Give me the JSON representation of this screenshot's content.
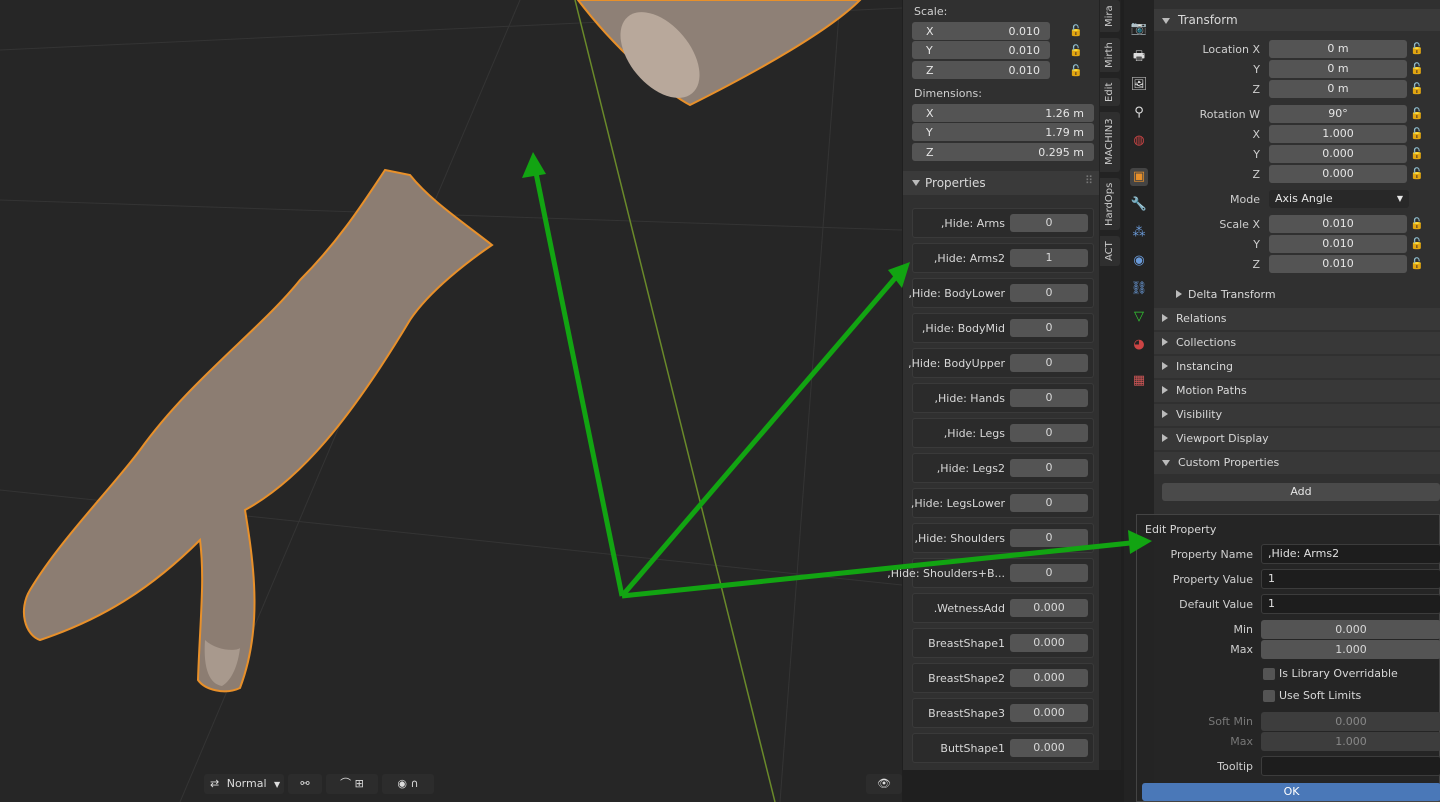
{
  "npanel": {
    "scale_label": "Scale:",
    "scale": [
      {
        "axis": "X",
        "value": "0.010"
      },
      {
        "axis": "Y",
        "value": "0.010"
      },
      {
        "axis": "Z",
        "value": "0.010"
      }
    ],
    "dimensions_label": "Dimensions:",
    "dimensions": [
      {
        "axis": "X",
        "value": "1.26 m"
      },
      {
        "axis": "Y",
        "value": "1.79 m"
      },
      {
        "axis": "Z",
        "value": "0.295 m"
      }
    ],
    "properties_title": "Properties",
    "properties": [
      {
        "name": ",Hide: Arms",
        "value": "0"
      },
      {
        "name": ",Hide: Arms2",
        "value": "1"
      },
      {
        "name": ",Hide: BodyLower",
        "value": "0"
      },
      {
        "name": ",Hide: BodyMid",
        "value": "0"
      },
      {
        "name": ",Hide: BodyUpper",
        "value": "0"
      },
      {
        "name": ",Hide: Hands",
        "value": "0"
      },
      {
        "name": ",Hide: Legs",
        "value": "0"
      },
      {
        "name": ",Hide: Legs2",
        "value": "0"
      },
      {
        "name": ",Hide: LegsLower",
        "value": "0"
      },
      {
        "name": ",Hide: Shoulders",
        "value": "0"
      },
      {
        "name": ",Hide: Shoulders+B...",
        "value": "0"
      },
      {
        "name": ".WetnessAdd",
        "value": "0.000"
      },
      {
        "name": "BreastShape1",
        "value": "0.000"
      },
      {
        "name": "BreastShape2",
        "value": "0.000"
      },
      {
        "name": "BreastShape3",
        "value": "0.000"
      },
      {
        "name": "ButtShape1",
        "value": "0.000"
      }
    ]
  },
  "tabs": [
    "Mira",
    "Mirth",
    "Edit",
    "MACHIN3",
    "HardOps",
    "ACT"
  ],
  "props": {
    "transform_title": "Transform",
    "location_label": "Location X",
    "location": [
      {
        "label": "Location X",
        "value": "0 m"
      },
      {
        "label": "Y",
        "value": "0 m"
      },
      {
        "label": "Z",
        "value": "0 m"
      }
    ],
    "rotation": [
      {
        "label": "Rotation W",
        "value": "90°"
      },
      {
        "label": "X",
        "value": "1.000"
      },
      {
        "label": "Y",
        "value": "0.000"
      },
      {
        "label": "Z",
        "value": "0.000"
      }
    ],
    "mode_label": "Mode",
    "mode_value": "Axis Angle",
    "scale": [
      {
        "label": "Scale X",
        "value": "0.010"
      },
      {
        "label": "Y",
        "value": "0.010"
      },
      {
        "label": "Z",
        "value": "0.010"
      }
    ],
    "delta_transform": "Delta Transform",
    "sections": [
      "Relations",
      "Collections",
      "Instancing",
      "Motion Paths",
      "Visibility",
      "Viewport Display"
    ],
    "custom_properties": "Custom Properties",
    "add_label": "Add"
  },
  "popup": {
    "title": "Edit Property",
    "property_name_label": "Property Name",
    "property_name": ",Hide: Arms2",
    "property_value_label": "Property Value",
    "property_value": "1",
    "default_value_label": "Default Value",
    "default_value": "1",
    "min_label": "Min",
    "min": "0.000",
    "max_label": "Max",
    "max": "1.000",
    "library_overridable": "Is Library Overridable",
    "soft_limits": "Use Soft Limits",
    "soft_min_label": "Soft Min",
    "soft_min": "0.000",
    "soft_max_label": "Max",
    "soft_max": "1.000",
    "tooltip_label": "Tooltip",
    "tooltip": "",
    "ok": "OK"
  },
  "toolbar": {
    "orientation": "Normal"
  },
  "colors": {
    "arrow": "#12a412",
    "outline": "#e8902a",
    "ok": "#4a78b8"
  }
}
